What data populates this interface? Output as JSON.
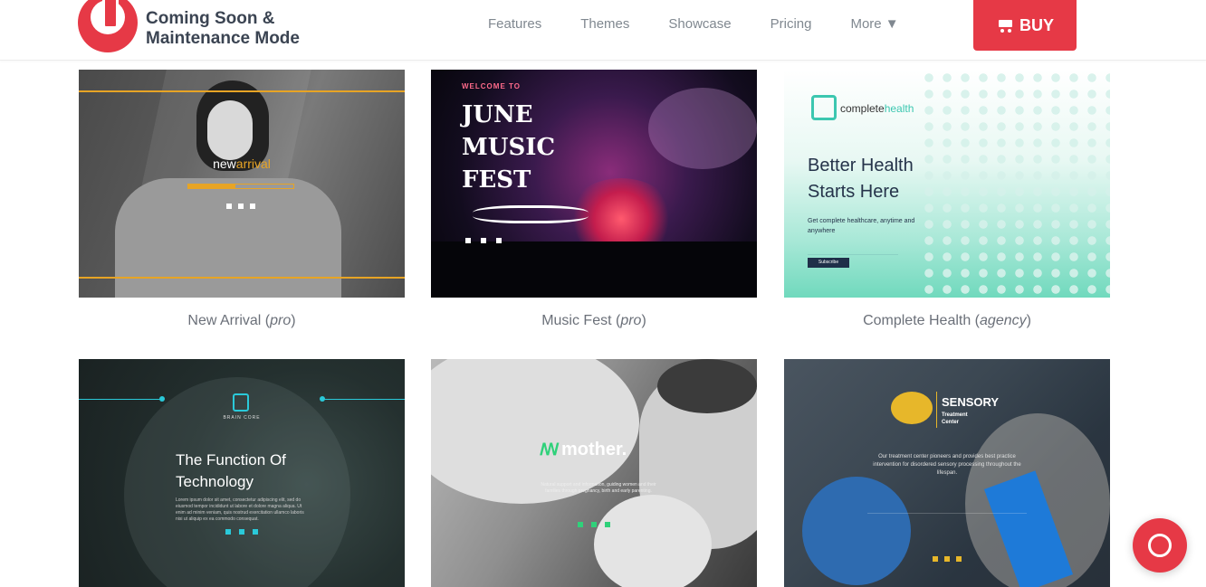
{
  "header": {
    "logo_line1": "Coming Soon &",
    "logo_line2": "Maintenance Mode",
    "nav": [
      {
        "label": "Features"
      },
      {
        "label": "Themes"
      },
      {
        "label": "Showcase"
      },
      {
        "label": "Pricing"
      },
      {
        "label": "More ▼"
      }
    ],
    "buy_label": "BUY",
    "accent": "#e63946"
  },
  "themes": [
    {
      "name": "New Arrival",
      "tier": "pro",
      "preview": {
        "brand_a": "new",
        "brand_b": "arrival",
        "progress": 0.45
      }
    },
    {
      "name": "Music Fest",
      "tier": "pro",
      "preview": {
        "welcome": "WELCOME TO",
        "line1": "JUNE",
        "line2": "MUSIC",
        "line3": "FEST"
      }
    },
    {
      "name": "Complete Health",
      "tier": "agency",
      "preview": {
        "brand_a": "complete",
        "brand_b": "health",
        "heading1": "Better Health",
        "heading2": "Starts Here",
        "text": "Get complete healthcare, anytime and anywhere",
        "button": "Subscribe"
      }
    },
    {
      "name": "Brain Core",
      "preview": {
        "brand": "BRAIN CORE",
        "heading1": "The Function Of",
        "heading2": "Technology",
        "text": "Lorem ipsum dolor sit amet, consectetur adipiscing elit, sed do eiusmod tempor incididunt ut labore et dolore magna aliqua. Ut enim ad minim veniam, quis nostrud exercitation ullamco laboris nisi ut aliquip ex ea commodo consequat."
      }
    },
    {
      "name": "Mother",
      "preview": {
        "brand": "mother.",
        "text": "Natural support and information, guiding women and their families through pregnancy, birth and early parenting."
      }
    },
    {
      "name": "Sensory",
      "preview": {
        "brand": "SENSORY",
        "sub1": "Treatment",
        "sub2": "Center",
        "text": "Our treatment center pioneers and provides best practice intervention for disordered sensory processing throughout the lifespan."
      }
    }
  ]
}
